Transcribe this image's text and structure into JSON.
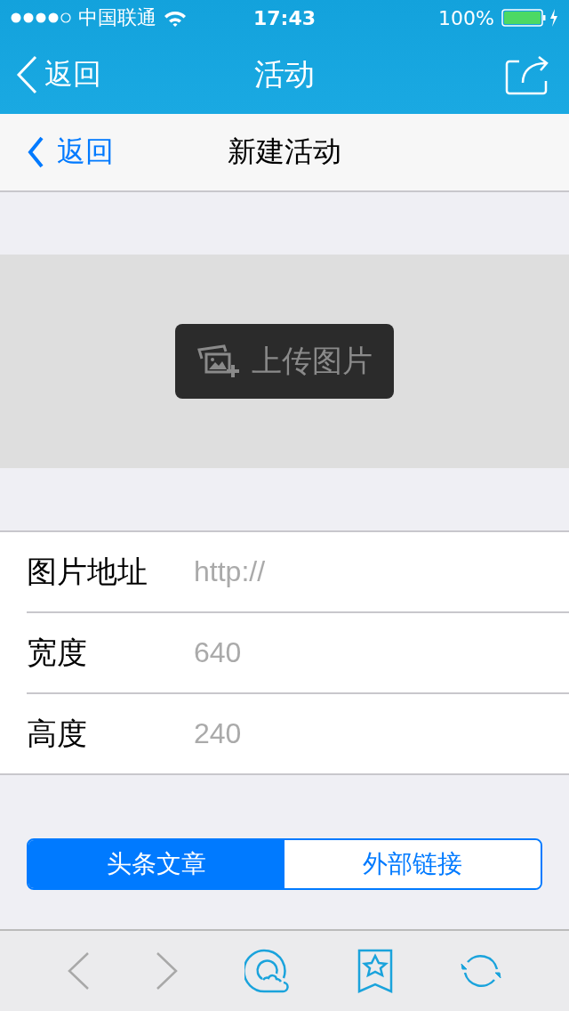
{
  "status_bar": {
    "carrier": "中国联通",
    "time": "17:43",
    "battery": "100%"
  },
  "nav_bar": {
    "back": "返回",
    "title": "活动"
  },
  "sub_nav": {
    "back": "返回",
    "title": "新建活动"
  },
  "upload_button": {
    "label": "上传图片"
  },
  "form": [
    {
      "label": "图片地址",
      "placeholder": "http://"
    },
    {
      "label": "宽度",
      "placeholder": "640"
    },
    {
      "label": "高度",
      "placeholder": "240"
    }
  ],
  "segments": [
    {
      "label": "头条文章",
      "selected": true
    },
    {
      "label": "外部链接",
      "selected": false
    }
  ],
  "toolbar": [
    {
      "kind": "back",
      "disabled": true
    },
    {
      "kind": "forward",
      "disabled": true
    },
    {
      "kind": "cloud",
      "disabled": false
    },
    {
      "kind": "bookmark",
      "disabled": false
    },
    {
      "kind": "refresh",
      "disabled": false
    }
  ]
}
